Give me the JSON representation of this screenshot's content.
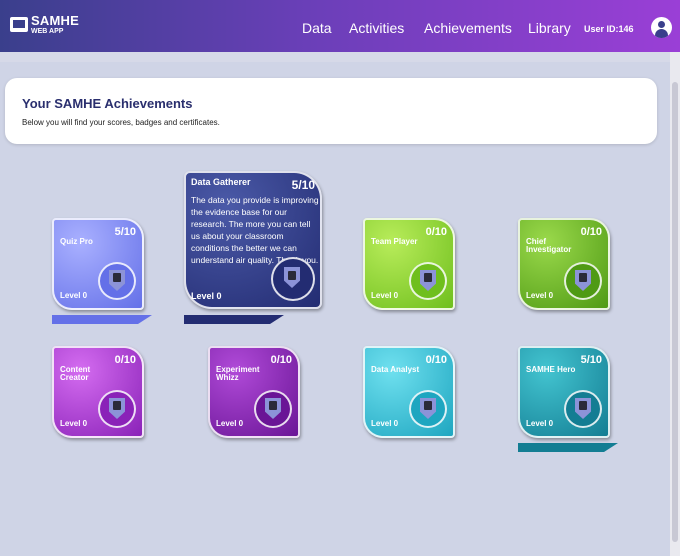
{
  "app": {
    "name": "SAMHE",
    "subtitle": "WEB APP"
  },
  "nav": {
    "items": [
      {
        "label": "Data"
      },
      {
        "label": "Activities"
      },
      {
        "label": "Achievements"
      },
      {
        "label": "Library"
      }
    ],
    "user_id": "User ID:146"
  },
  "header": {
    "title": "Your SAMHE Achievements",
    "subtitle": "Below you will find your scores, badges and certificates."
  },
  "badges": [
    {
      "name": "Quiz Pro",
      "score": "5/10",
      "level": "Level 0",
      "icon": "quiz-icon",
      "progress": 0.5,
      "color_top": "#a9b0ff",
      "color_bottom": "#6470e8"
    },
    {
      "name": "Data Gatherer",
      "score": "5/10",
      "level": "Level 0",
      "icon": "data-gatherer-icon",
      "progress": 0.5,
      "expanded": true,
      "description": "The data you provide is improving the evidence base for our research. The more you can tell us about your classroom conditions the better we can understand air quality. Thank you.",
      "color_top": "#4b5aa8",
      "color_bottom": "#232c72"
    },
    {
      "name": "Team Player",
      "score": "0/10",
      "level": "Level 0",
      "icon": "team-icon",
      "progress": 0,
      "color_top": "#b8ec5a",
      "color_bottom": "#6fbf1d"
    },
    {
      "name": "Chief Investigator",
      "score": "0/10",
      "level": "Level 0",
      "icon": "magnifier-icon",
      "progress": 0,
      "color_top": "#9ad94b",
      "color_bottom": "#4f9a14"
    },
    {
      "name": "Content Creator",
      "score": "0/10",
      "level": "Level 0",
      "icon": "content-icon",
      "progress": 0,
      "color_top": "#d46cf0",
      "color_bottom": "#8a22b8"
    },
    {
      "name": "Experiment Whizz",
      "score": "0/10",
      "level": "Level 0",
      "icon": "experiment-icon",
      "progress": 0,
      "color_top": "#b04ad8",
      "color_bottom": "#6a1596"
    },
    {
      "name": "Data Analyst",
      "score": "0/10",
      "level": "Level 0",
      "icon": "analyst-icon",
      "progress": 0,
      "color_top": "#6fe0ef",
      "color_bottom": "#1ea6c0"
    },
    {
      "name": "SAMHE Hero",
      "score": "5/10",
      "level": "Level 0",
      "icon": "hero-icon",
      "progress": 0.5,
      "color_top": "#43c4d0",
      "color_bottom": "#137d93"
    }
  ]
}
